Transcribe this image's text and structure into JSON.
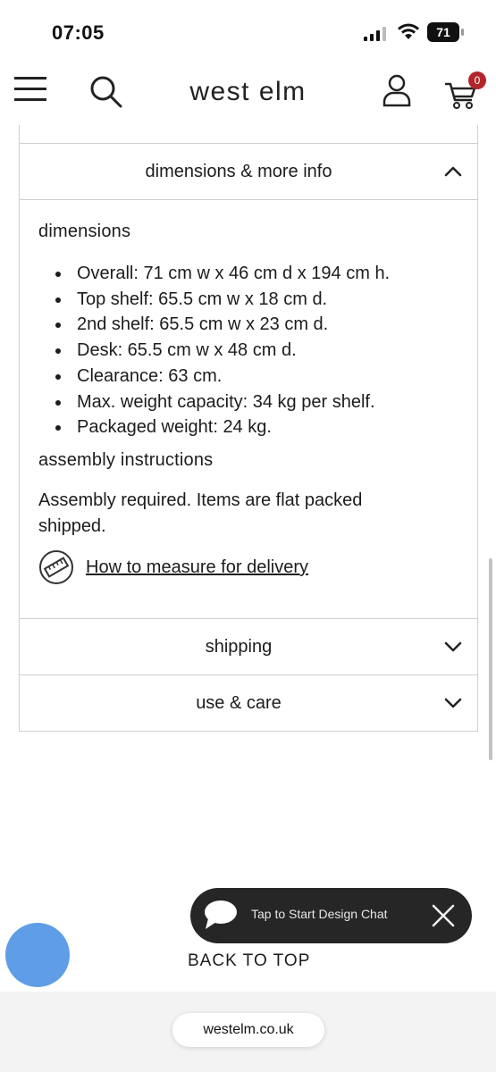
{
  "status_bar": {
    "time": "07:05",
    "battery": "71"
  },
  "header": {
    "brand": "west elm",
    "cart_count": "0"
  },
  "accordion": {
    "dimensions_title": "dimensions & more info",
    "shipping_title": "shipping",
    "care_title": "use & care"
  },
  "dimensions": {
    "heading": "dimensions",
    "items": [
      "Overall: 71 cm w x 46 cm d x 194 cm h.",
      "Top shelf: 65.5 cm w x 18 cm d.",
      "2nd shelf: 65.5 cm w x 23 cm d.",
      "Desk: 65.5 cm w x 48 cm d.",
      "Clearance: 63 cm.",
      "Max. weight capacity: 34 kg per shelf.",
      "Packaged weight: 24 kg."
    ]
  },
  "assembly": {
    "heading": "assembly instructions",
    "text": "Assembly required. Items are flat packed shipped."
  },
  "measure_link": "How to measure for delivery",
  "chat": {
    "label": "Tap to Start Design Chat"
  },
  "back_to_top": "BACK TO TOP",
  "browser": {
    "url": "westelm.co.uk"
  },
  "colors": {
    "cart_badge": "#b3262b",
    "chat_bg": "#262626",
    "fab": "#5f9ee6"
  }
}
